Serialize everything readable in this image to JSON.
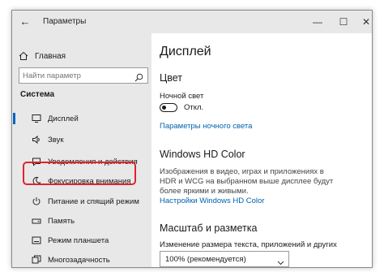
{
  "window": {
    "title": "Параметры",
    "back_glyph": "←",
    "min_glyph": "—",
    "max_glyph": "☐",
    "close_glyph": "✕"
  },
  "sidebar": {
    "home_label": "Главная",
    "search_placeholder": "Найти параметр",
    "section": "Система",
    "items": [
      {
        "label": "Дисплей",
        "icon": "monitor-icon",
        "active": true
      },
      {
        "label": "Звук",
        "icon": "speaker-icon",
        "active": false
      },
      {
        "label": "Уведомления и действия",
        "icon": "notification-icon",
        "active": false,
        "highlighted": true
      },
      {
        "label": "Фокусировка внимания",
        "icon": "moon-icon",
        "active": false
      },
      {
        "label": "Питание и спящий режим",
        "icon": "power-icon",
        "active": false
      },
      {
        "label": "Память",
        "icon": "storage-icon",
        "active": false
      },
      {
        "label": "Режим планшета",
        "icon": "tablet-icon",
        "active": false
      },
      {
        "label": "Многозадачность",
        "icon": "multitask-icon",
        "active": false
      }
    ]
  },
  "main": {
    "title": "Дисплей",
    "color_heading": "Цвет",
    "night_light_label": "Ночной свет",
    "night_light_state": "Откл.",
    "night_light_settings_link": "Параметры ночного света",
    "hdr_heading": "Windows HD Color",
    "hdr_description": "Изображения в видео, играх и приложениях в HDR и WCG на выбранном выше дисплее будут более яркими и живыми.",
    "hdr_settings_link": "Настройки Windows HD Color",
    "scale_heading": "Масштаб и разметка",
    "scale_label": "Изменение размера текста, приложений и других элементов",
    "scale_value": "100% (рекомендуется)"
  },
  "colors": {
    "accent": "#0067c0",
    "link": "#0063b1",
    "highlight_border": "#e0242a",
    "sidebar_bg": "#e8e8e8"
  }
}
